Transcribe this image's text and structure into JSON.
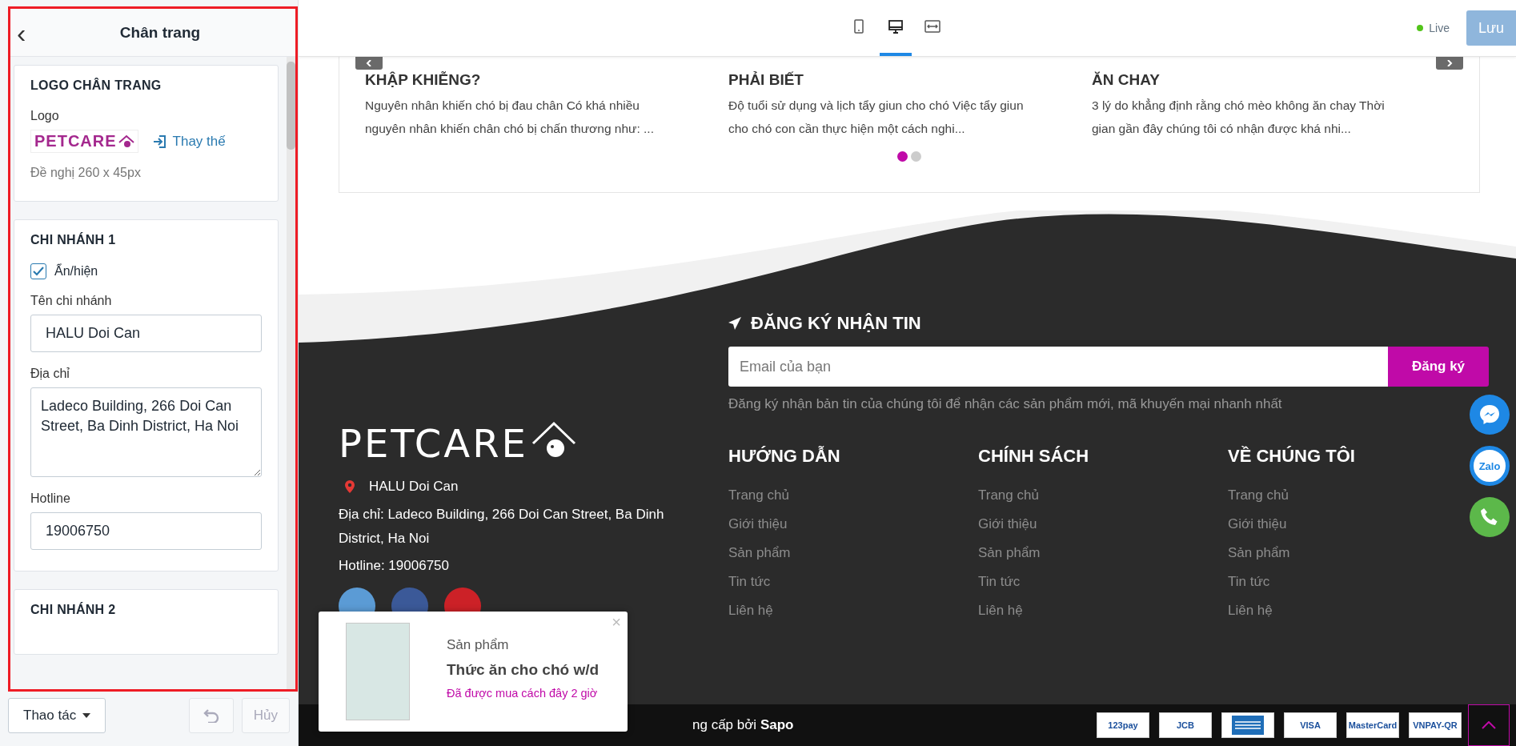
{
  "editor": {
    "title": "Chân trang",
    "back": "‹",
    "sections": [
      {
        "kind": "logo",
        "title": "LOGO CHÂN TRANG",
        "label": "Logo",
        "logo_text": "PETCARE",
        "replace": "Thay thế",
        "hint": "Đề nghị 260 x 45px"
      },
      {
        "kind": "branch",
        "title": "CHI NHÁNH 1",
        "toggle": {
          "label": "Ẩn/hiện",
          "checked": true
        },
        "fields": [
          {
            "kind": "input",
            "label": "Tên chi nhánh",
            "value": "HALU Doi Can"
          },
          {
            "kind": "textarea",
            "label": "Địa chỉ",
            "value": "Ladeco Building, 266 Doi Can Street, Ba Dinh District, Ha Noi"
          },
          {
            "kind": "input",
            "label": "Hotline",
            "value": "19006750"
          }
        ]
      },
      {
        "kind": "branch",
        "title": "CHI NHÁNH 2"
      }
    ],
    "actions": {
      "menu": "Thao tác",
      "undo": {
        "disabled": true
      },
      "cancel": {
        "label": "Hủy",
        "disabled": true
      }
    }
  },
  "toolbar": {
    "devices": [
      {
        "kind": "mobile",
        "selected": false
      },
      {
        "kind": "desktop",
        "selected": true
      },
      {
        "kind": "fullwidth",
        "selected": false
      }
    ],
    "live": "Live",
    "save": "Lưu"
  },
  "articles": [
    {
      "title": "KHẬP KHIỄNG?",
      "excerpt": "Nguyên nhân khiến chó bị đau chân Có khá nhiều nguyên nhân khiến chân chó bị chấn thương như: ..."
    },
    {
      "title": "PHẢI BIẾT",
      "excerpt": "Độ tuổi sử dụng và lịch tẩy giun cho chó Việc tẩy giun cho chó con cần thực hiện một cách nghi..."
    },
    {
      "title": "ĂN CHAY",
      "excerpt": "3 lý do khẳng định rằng chó mèo không ăn chay Thời gian gần đây chúng tôi có nhận được khá nhi..."
    }
  ],
  "carousel_dots": [
    {
      "selected": true
    },
    {
      "selected": false
    }
  ],
  "footer": {
    "logo_text": "PETCARE",
    "branch": "HALU Doi Can",
    "address": "Địa chỉ: Ladeco Building, 266 Doi Can Street, Ba Dinh District, Ha Noi",
    "hotline": "Hotline: 19006750",
    "social": [
      {
        "color": "#5b9bd5"
      },
      {
        "color": "#3b5998"
      },
      {
        "color": "#cc2127"
      }
    ],
    "newsletter": {
      "title": "ĐĂNG KÝ NHẬN TIN",
      "placeholder": "Email của bạn",
      "button": "Đăng ký",
      "note": "Đăng ký nhận bản tin của chúng tôi để nhận các sản phẩm mới, mã khuyến mại nhanh nhất"
    },
    "columns": [
      {
        "title": "HƯỚNG DẪN",
        "links": [
          "Trang chủ",
          "Giới thiệu",
          "Sản phẩm",
          "Tin tức",
          "Liên hệ"
        ]
      },
      {
        "title": "CHÍNH SÁCH",
        "links": [
          "Trang chủ",
          "Giới thiệu",
          "Sản phẩm",
          "Tin tức",
          "Liên hệ"
        ]
      },
      {
        "title": "VỀ CHÚNG TÔI",
        "links": [
          "Trang chủ",
          "Giới thiệu",
          "Sản phẩm",
          "Tin tức",
          "Liên hệ"
        ]
      }
    ],
    "copyright": "ng cấp bởi **Sapo**",
    "payments": [
      {
        "kind": "text",
        "label": "123pay"
      },
      {
        "kind": "text",
        "label": "JCB"
      },
      {
        "kind": "card"
      },
      {
        "kind": "text",
        "label": "VISA"
      },
      {
        "kind": "text",
        "label": "MasterCard"
      },
      {
        "kind": "text",
        "label": "VNPAY-QR"
      }
    ]
  },
  "popup": {
    "category": "Sản phẩm",
    "product": "Thức ăn cho chó w/d",
    "time": "Đã được mua cách đây 2 giờ",
    "close": "×"
  },
  "contact_buttons": [
    {
      "kind": "messenger"
    },
    {
      "kind": "zalo",
      "label": "Zalo"
    },
    {
      "kind": "phone"
    }
  ]
}
